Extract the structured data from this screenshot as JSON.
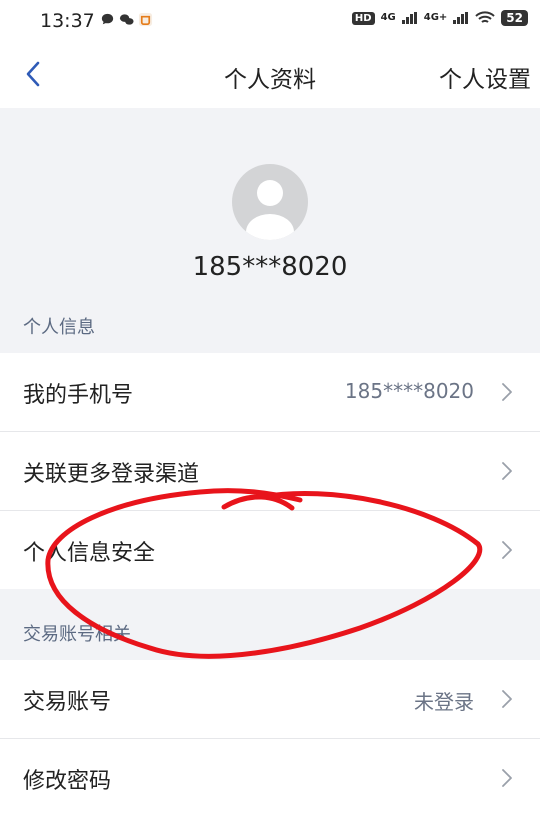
{
  "status_bar": {
    "time": "13:37",
    "hd": "HD",
    "signal1": "4G",
    "signal2": "4G+",
    "battery": "52"
  },
  "nav": {
    "title": "个人资料",
    "action": "个人设置"
  },
  "profile": {
    "phone": "185***8020"
  },
  "sections": {
    "personal": {
      "label": "个人信息",
      "rows": [
        {
          "label": "我的手机号",
          "value": "185****8020"
        },
        {
          "label": "关联更多登录渠道",
          "value": ""
        },
        {
          "label": "个人信息安全",
          "value": ""
        }
      ]
    },
    "trading": {
      "label": "交易账号相关",
      "rows": [
        {
          "label": "交易账号",
          "value": "未登录"
        },
        {
          "label": "修改密码",
          "value": ""
        }
      ]
    }
  },
  "colors": {
    "accent": "#2f5bb7",
    "annotation": "#e8141b",
    "section_text": "#5c6a82"
  }
}
